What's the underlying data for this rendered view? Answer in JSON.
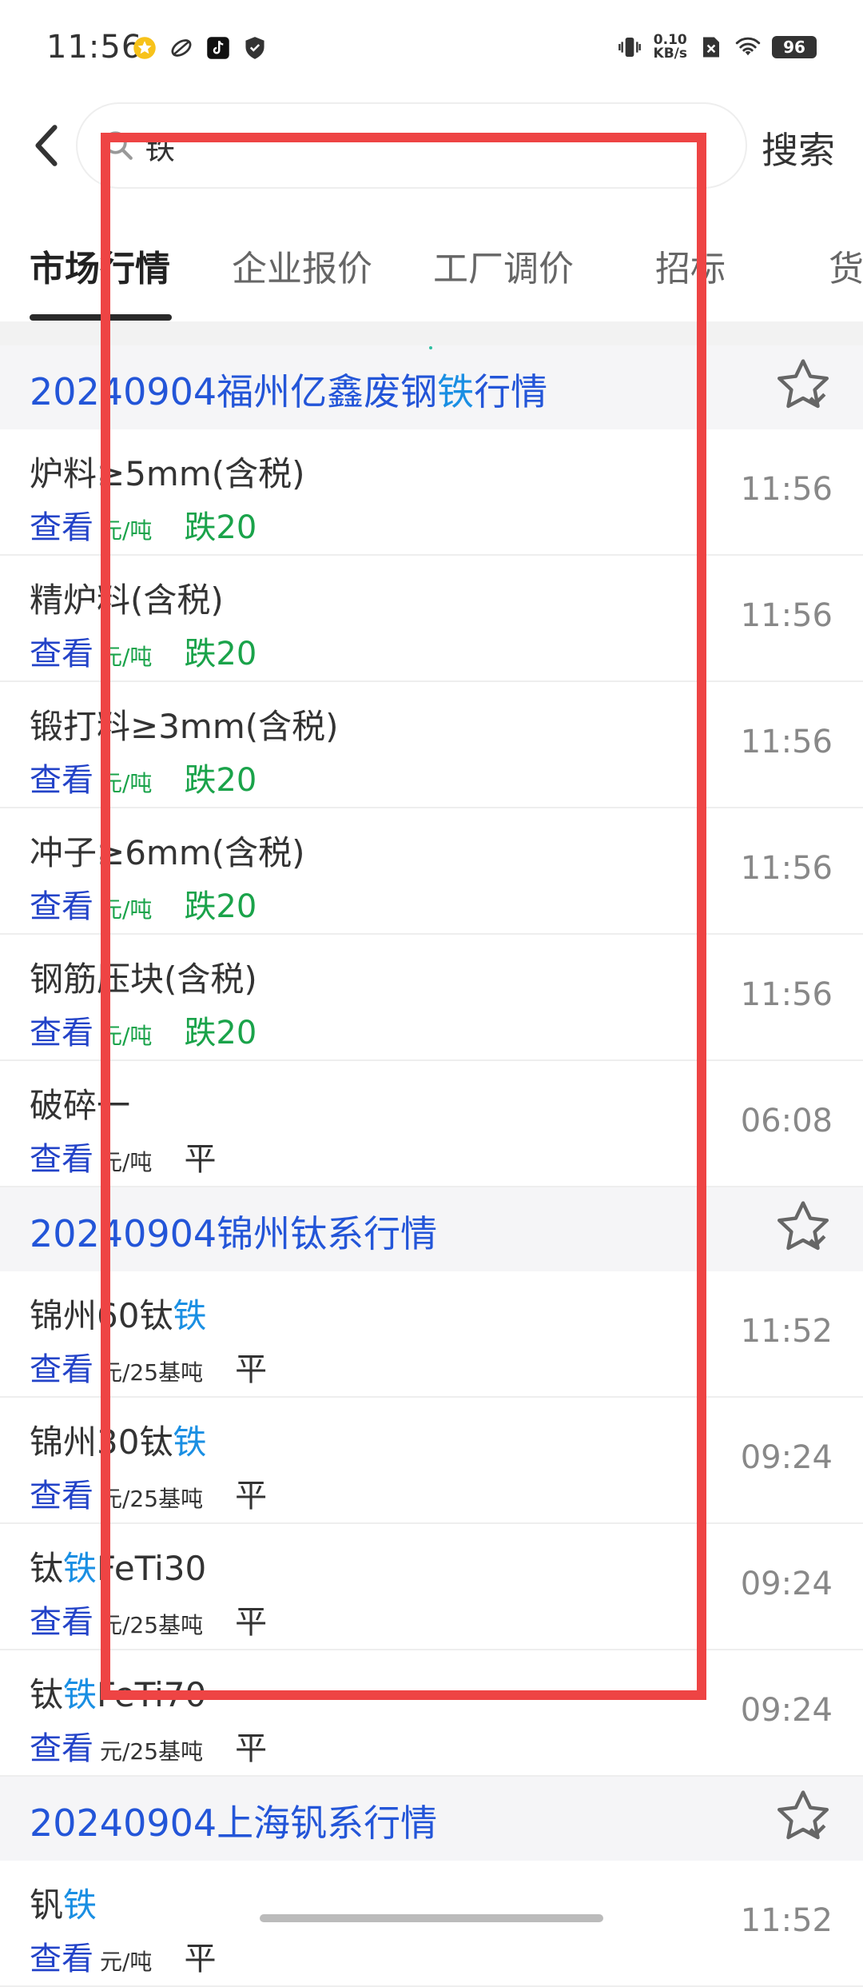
{
  "status_bar": {
    "time": "11:56",
    "icons_left": [
      "star-badge-icon",
      "leaf-icon",
      "tiktok-icon",
      "shield-icon"
    ],
    "speed_value": "0.10",
    "speed_unit": "KB/s",
    "battery": "96",
    "icons_right": [
      "vibrate-icon",
      "no-sim-icon",
      "wifi-icon"
    ]
  },
  "search": {
    "query": "铁",
    "button_label": "搜索"
  },
  "tabs": [
    {
      "label": "市场行情",
      "active": true
    },
    {
      "label": "企业报价",
      "active": false
    },
    {
      "label": "工厂调价",
      "active": false
    },
    {
      "label": "招标",
      "active": false
    },
    {
      "label": "货",
      "active": false
    }
  ],
  "sections": [
    {
      "title_pre": "20240904福州亿鑫废钢",
      "title_hl": "铁",
      "title_post": "行情",
      "items": [
        {
          "name_pre": "炉料≥5mm(含税)",
          "name_hl": "",
          "name_post": "",
          "view": "查看",
          "unit": "元/吨",
          "change": "跌20",
          "trend": "down",
          "time": "11:56"
        },
        {
          "name_pre": "精炉料(含税)",
          "name_hl": "",
          "name_post": "",
          "view": "查看",
          "unit": "元/吨",
          "change": "跌20",
          "trend": "down",
          "time": "11:56"
        },
        {
          "name_pre": "锻打料≥3mm(含税)",
          "name_hl": "",
          "name_post": "",
          "view": "查看",
          "unit": "元/吨",
          "change": "跌20",
          "trend": "down",
          "time": "11:56"
        },
        {
          "name_pre": "冲子≥6mm(含税)",
          "name_hl": "",
          "name_post": "",
          "view": "查看",
          "unit": "元/吨",
          "change": "跌20",
          "trend": "down",
          "time": "11:56"
        },
        {
          "name_pre": "钢筋压块(含税)",
          "name_hl": "",
          "name_post": "",
          "view": "查看",
          "unit": "元/吨",
          "change": "跌20",
          "trend": "down",
          "time": "11:56"
        },
        {
          "name_pre": "破碎一",
          "name_hl": "",
          "name_post": "",
          "view": "查看",
          "unit": "元/吨",
          "change": "平",
          "trend": "flat",
          "time": "06:08"
        }
      ]
    },
    {
      "title_pre": "20240904锦州钛系行情",
      "title_hl": "",
      "title_post": "",
      "items": [
        {
          "name_pre": "锦州60钛",
          "name_hl": "铁",
          "name_post": "",
          "view": "查看",
          "unit": "元/25基吨",
          "change": "平",
          "trend": "flat",
          "time": "11:52"
        },
        {
          "name_pre": "锦州30钛",
          "name_hl": "铁",
          "name_post": "",
          "view": "查看",
          "unit": "元/25基吨",
          "change": "平",
          "trend": "flat",
          "time": "09:24"
        },
        {
          "name_pre": "钛",
          "name_hl": "铁",
          "name_post": "FeTi30",
          "view": "查看",
          "unit": "元/25基吨",
          "change": "平",
          "trend": "flat",
          "time": "09:24"
        },
        {
          "name_pre": "钛",
          "name_hl": "铁",
          "name_post": "FeTi70",
          "view": "查看",
          "unit": "元/25基吨",
          "change": "平",
          "trend": "flat",
          "time": "09:24"
        }
      ]
    },
    {
      "title_pre": "20240904上海钒系行情",
      "title_hl": "",
      "title_post": "",
      "items": [
        {
          "name_pre": "钒",
          "name_hl": "铁",
          "name_post": "",
          "view": "查看",
          "unit": "元/吨",
          "change": "平",
          "trend": "flat",
          "time": "11:52"
        }
      ]
    }
  ],
  "colors": {
    "section_title": "#2355d8",
    "highlight": "#1a8fe3",
    "view_link": "#2343c8",
    "down": "#1aa34a",
    "annotation": "#ee4444"
  }
}
